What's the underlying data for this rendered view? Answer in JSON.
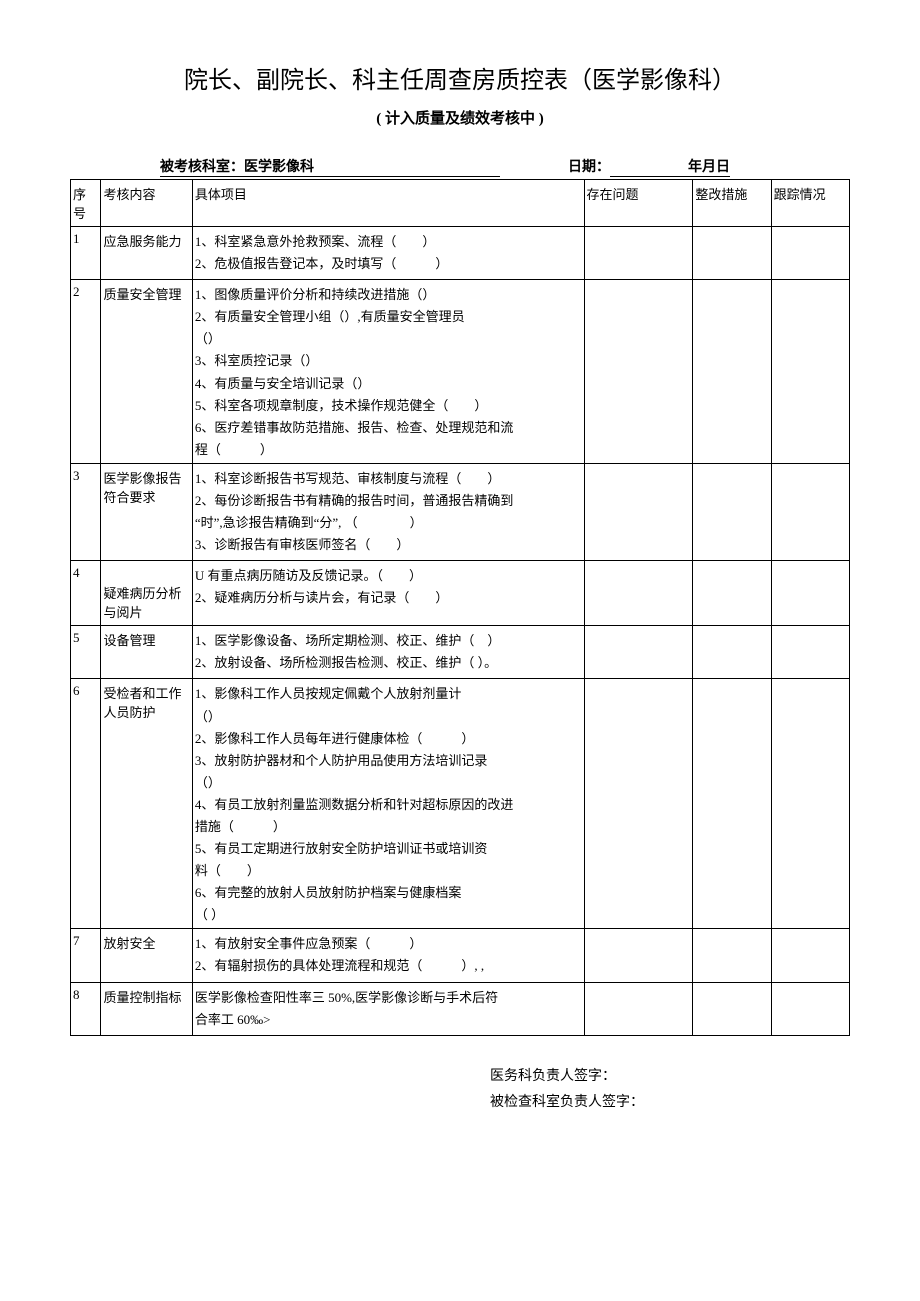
{
  "title": "院长、副院长、科主任周查房质控表（医学影像科）",
  "subtitle": "( 计入质量及绩效考核中 )",
  "info": {
    "dept_label": "被考核科室：医学影像科",
    "date_label": "日期：",
    "date_suffix": "年月日"
  },
  "headers": {
    "no": "序号",
    "category": "考核内容",
    "item": "具体项目",
    "issue": "存在问题",
    "fix": "整改措施",
    "track": "跟踪情况"
  },
  "rows": [
    {
      "no": "1",
      "category": "应急服务能力",
      "items": [
        "1、科室紧急意外抢救预案、流程（　　）",
        "2、危极值报告登记本，及时填写（　　　）"
      ]
    },
    {
      "no": "2",
      "category": "质量安全管理",
      "items": [
        "1、图像质量评价分析和持续改进措施（）",
        "2、有质量安全管理小组（）,有质量安全管理员",
        "（）",
        "3、科室质控记录（）",
        "4、有质量与安全培训记录（）",
        "5、科室各项规章制度，技术操作规范健全（　　）",
        "6、医疗差错事故防范措施、报告、检查、处理规范和流",
        "程（　　　）"
      ],
      "clip_last": true
    },
    {
      "no": "3",
      "category": "医学影像报告符合要求",
      "items": [
        "1、科室诊断报告书写规范、审核制度与流程（　　）",
        "2、每份诊断报告书有精确的报告时间，普通报告精确到",
        "“时”,急诊报告精确到“分”, （　　　　）",
        "3、诊断报告有审核医师签名（　　）"
      ]
    },
    {
      "no": "4",
      "category": "疑难病历分析与阅片",
      "cat_offset": true,
      "items": [
        "U 有重点病历随访及反馈记录。（　　）",
        "2、疑难病历分析与读片会，有记录（　　）",
        ""
      ]
    },
    {
      "no": "5",
      "category": "设备管理",
      "items": [
        "1、医学影像设备、场所定期检测、校正、维护（　）",
        "2、放射设备、场所检测报告检测、校正、维护（ ）。"
      ]
    },
    {
      "no": "6",
      "category": "受检者和工作人员防护",
      "items": [
        "1、影像科工作人员按规定佩戴个人放射剂量计",
        "（）",
        "2、影像科工作人员每年进行健康体检（　　　）",
        "3、放射防护器材和个人防护用品使用方法培训记录",
        "（）",
        "4、有员工放射剂量监测数据分析和针对超标原因的改进",
        "措施（　　　）",
        "5、有员工定期进行放射安全防护培训证书或培训资",
        "料（　　）",
        "6、有完整的放射人员放射防护档案与健康档案",
        "（ ）"
      ],
      "clip_last": true
    },
    {
      "no": "7",
      "category": "放射安全",
      "items": [
        "1、有放射安全事件应急预案（　　　）",
        "2、有辐射损伤的具体处理流程和规范（　　　）, ,"
      ]
    },
    {
      "no": "8",
      "category": "质量控制指标",
      "items": [
        "医学影像检查阳性率三 50%,医学影像诊断与手术后符",
        "合率工 60‰>"
      ]
    }
  ],
  "signatures": {
    "line1": "医务科负责人签字：",
    "line2": "被检查科室负责人签字："
  }
}
